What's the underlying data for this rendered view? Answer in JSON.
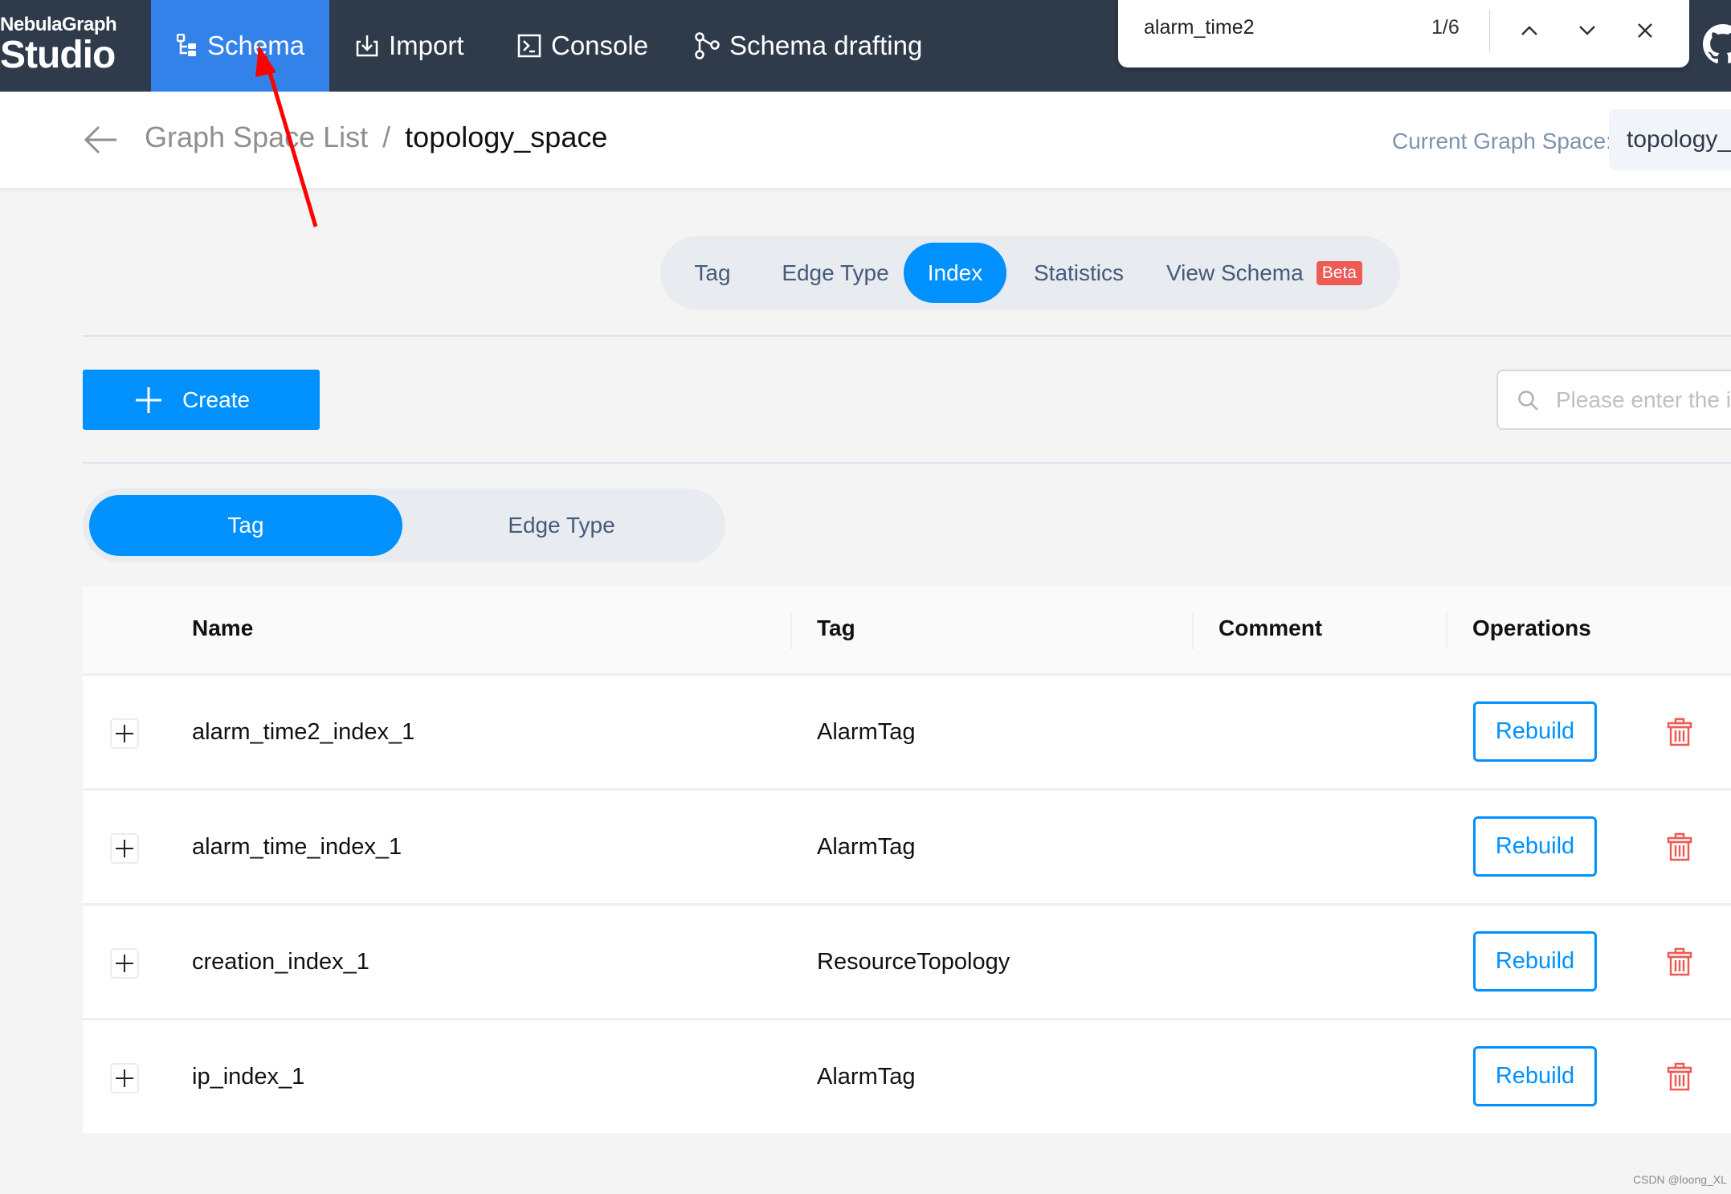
{
  "nav": {
    "logo_line1": "NebulaGraph",
    "logo_line2": "Studio",
    "items": [
      {
        "label": "Schema",
        "icon": "schema-tree-icon",
        "active": true
      },
      {
        "label": "Import",
        "icon": "import-icon",
        "active": false
      },
      {
        "label": "Console",
        "icon": "console-icon",
        "active": false
      },
      {
        "label": "Schema drafting",
        "icon": "schema-drafting-icon",
        "active": false
      }
    ],
    "github_icon": "github-icon"
  },
  "find_bar": {
    "query": "alarm_time2",
    "count": "1/6"
  },
  "header": {
    "breadcrumb_parent": "Graph Space List",
    "breadcrumb_separator": "/",
    "breadcrumb_current": "topology_space",
    "current_space_label": "Current Graph Space:",
    "current_space_value": "topology_space"
  },
  "schema_tabs": [
    {
      "label": "Tag",
      "active": false
    },
    {
      "label": "Edge Type",
      "active": false
    },
    {
      "label": "Index",
      "active": true
    },
    {
      "label": "Statistics",
      "active": false
    },
    {
      "label": "View Schema",
      "active": false,
      "badge": "Beta"
    }
  ],
  "toolbar": {
    "create_label": "Create",
    "search_placeholder": "Please enter the index name"
  },
  "index_type_toggle": [
    {
      "label": "Tag",
      "active": true
    },
    {
      "label": "Edge Type",
      "active": false
    }
  ],
  "table": {
    "columns": [
      "Name",
      "Tag",
      "Comment",
      "Operations"
    ],
    "rows": [
      {
        "name": "alarm_time2_index_1",
        "tag": "AlarmTag",
        "comment": "",
        "action": "Rebuild"
      },
      {
        "name": "alarm_time_index_1",
        "tag": "AlarmTag",
        "comment": "",
        "action": "Rebuild"
      },
      {
        "name": "creation_index_1",
        "tag": "ResourceTopology",
        "comment": "",
        "action": "Rebuild"
      },
      {
        "name": "ip_index_1",
        "tag": "AlarmTag",
        "comment": "",
        "action": "Rebuild"
      }
    ]
  },
  "colors": {
    "nav_bg": "#2f3a4b",
    "nav_active": "#3282e9",
    "primary": "#0091ff",
    "danger": "#ec5b56",
    "annotation_arrow": "#ff0000"
  },
  "watermark": "CSDN @loong_XL"
}
